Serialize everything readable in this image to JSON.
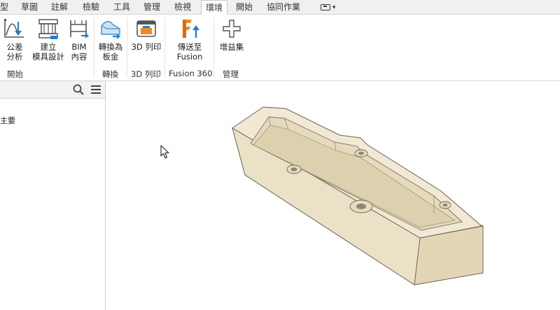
{
  "tabs": [
    {
      "label": "型",
      "active": false
    },
    {
      "label": "草圖",
      "active": false
    },
    {
      "label": "註解",
      "active": false
    },
    {
      "label": "檢驗",
      "active": false
    },
    {
      "label": "工具",
      "active": false
    },
    {
      "label": "管理",
      "active": false
    },
    {
      "label": "檢視",
      "active": false
    },
    {
      "label": "環境",
      "active": true
    },
    {
      "label": "開始",
      "active": false
    },
    {
      "label": "協同作業",
      "active": false
    }
  ],
  "ribbon": {
    "tolerance_analysis": {
      "line1": "公差",
      "line2": "分析"
    },
    "mold_design": {
      "line1": "建立",
      "line2": "模具設計"
    },
    "bim_content": {
      "line1": "BIM",
      "line2": "內容"
    },
    "convert_sheetmetal": {
      "line1": "轉換為",
      "line2": "板金"
    },
    "print_3d": {
      "line1": "3D 列印"
    },
    "send_to_fusion": {
      "line1": "傳送至",
      "line2": "Fusion"
    },
    "add_ins": {
      "line1": "增益集"
    },
    "panels": {
      "start": "開始",
      "convert": "轉換",
      "print3d": "3D 列印",
      "fusion360": "Fusion 360",
      "manage": "管理"
    }
  },
  "browser": {
    "item": "主要"
  },
  "colors": {
    "accent_blue": "#1d7fd8",
    "fusion_orange": "#f08a24",
    "part_fill": "#efe6cf",
    "part_edge": "#6b6455"
  },
  "icons": [
    "tolerance-analysis-icon",
    "mold-design-icon",
    "bim-content-icon",
    "sheetmetal-convert-icon",
    "printer-3d-icon",
    "fusion-logo-icon",
    "plus-icon",
    "search-icon",
    "hamburger-menu-icon",
    "mouse-cursor-icon",
    "tray-dropdown-icon"
  ]
}
